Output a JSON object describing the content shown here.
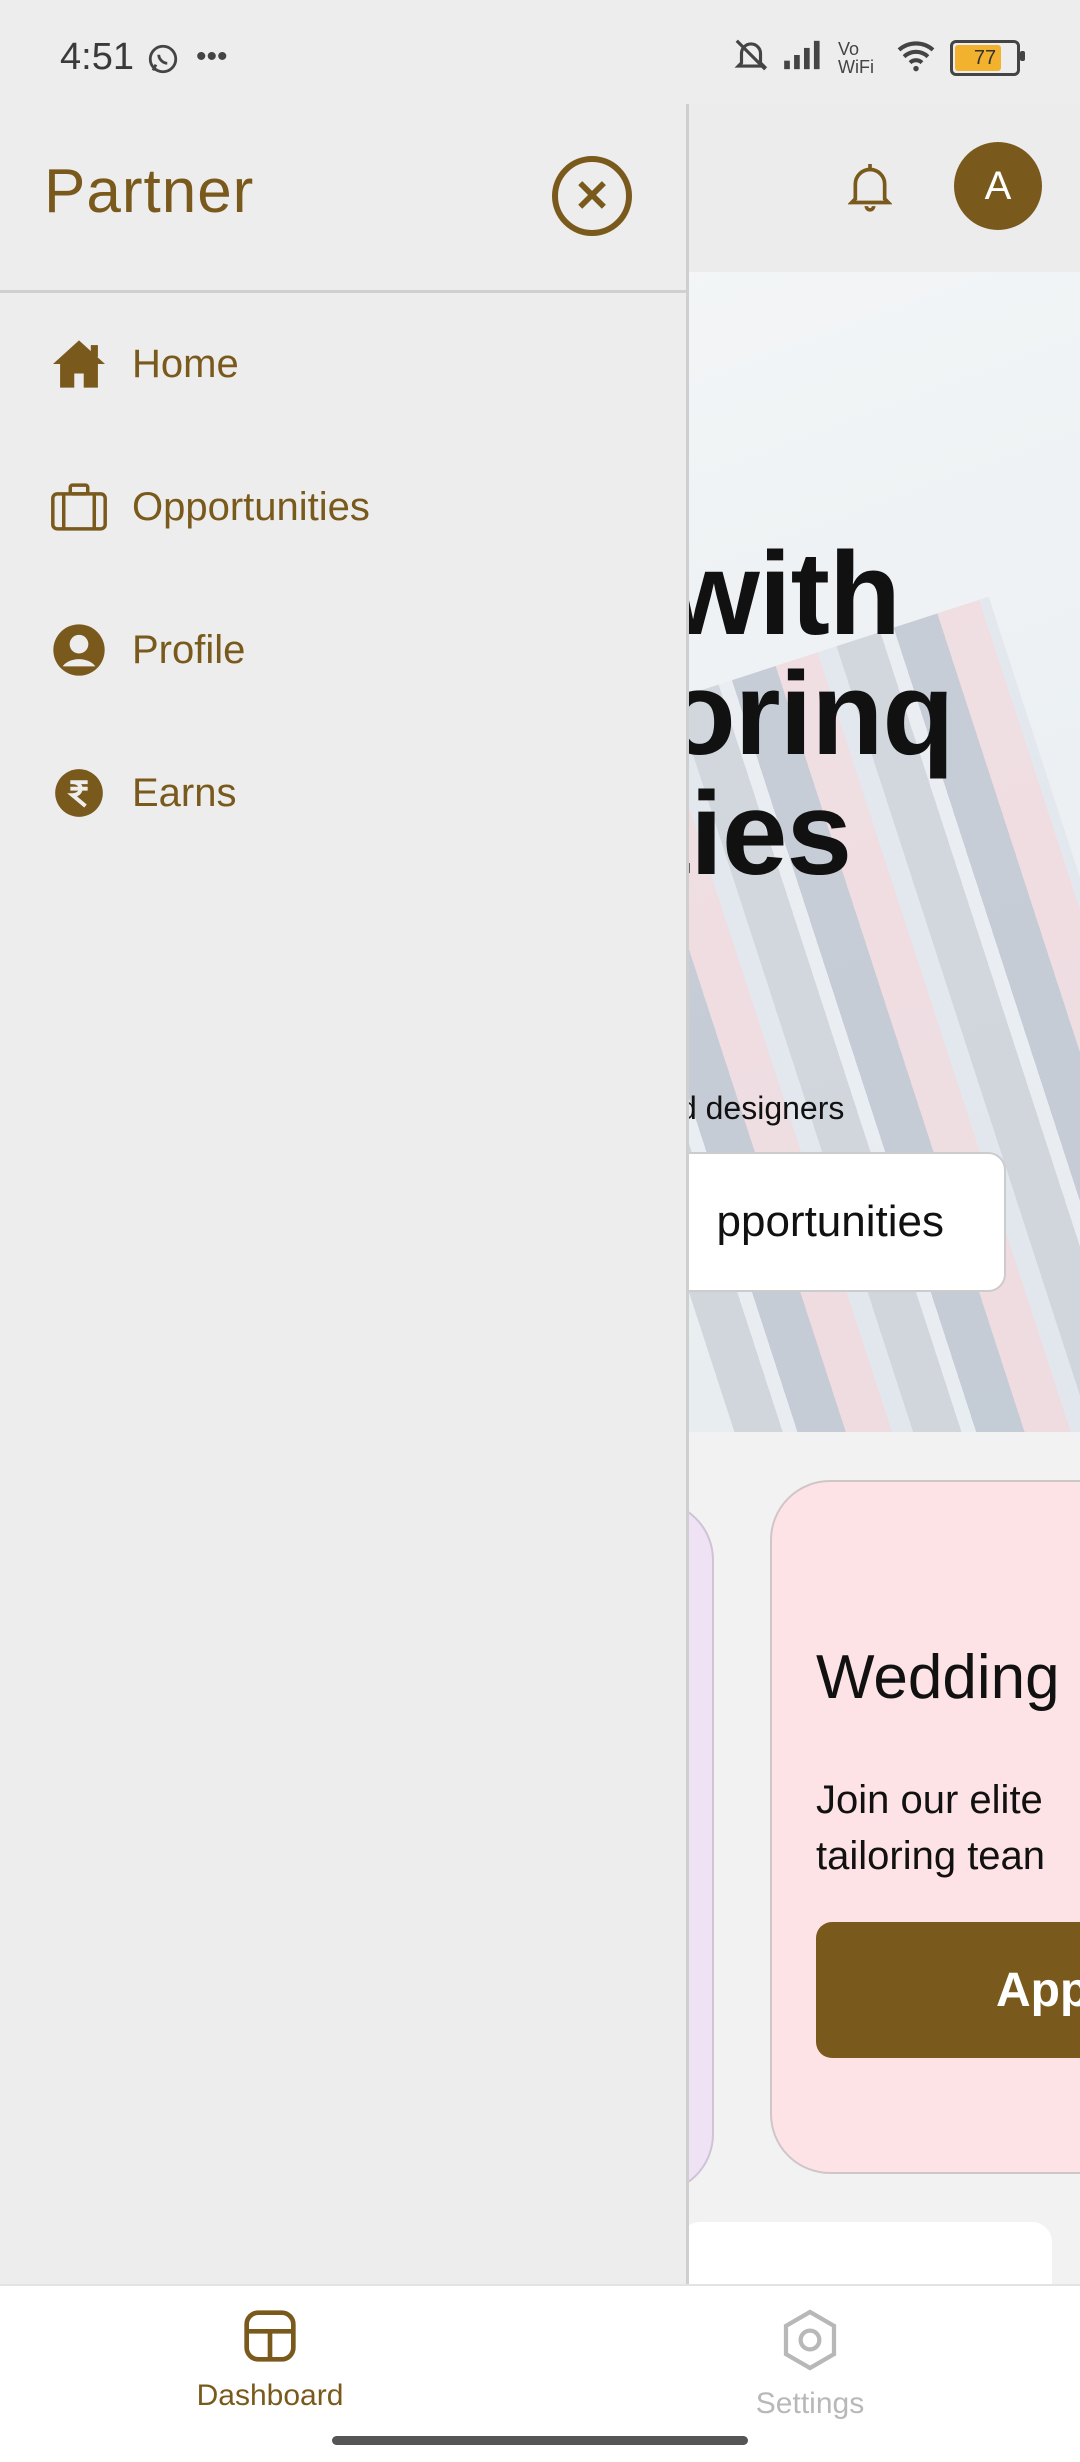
{
  "status_bar": {
    "time": "4:51",
    "network_label": "Vo WiFi",
    "battery_percent": "77"
  },
  "drawer": {
    "title": "Partner",
    "items": [
      {
        "label": "Home",
        "icon": "home-icon"
      },
      {
        "label": "Opportunities",
        "icon": "briefcase-icon"
      },
      {
        "label": "Profile",
        "icon": "user-icon"
      },
      {
        "label": "Earns",
        "icon": "rupee-icon"
      }
    ]
  },
  "header": {
    "avatar_initial": "A"
  },
  "hero": {
    "title_lines": [
      "with",
      "ilorinq",
      "ities"
    ],
    "subtitle": "ors and designers",
    "cta_label": "pportunities"
  },
  "cards": {
    "wedding": {
      "title": "Wedding",
      "desc_line1": "Join our elite",
      "desc_line2": "tailoring tean",
      "button": "App"
    }
  },
  "bottom_nav": {
    "items": [
      {
        "label": "Dashboard",
        "active": true
      },
      {
        "label": "Settings",
        "active": false
      }
    ]
  },
  "colors": {
    "accent": "#7a5a1c",
    "drawer_bg": "#ededed",
    "wedding_card_bg": "#fde3e6",
    "lavender_card_bg": "#efe2f5",
    "inactive_nav": "#b8b8b8"
  }
}
